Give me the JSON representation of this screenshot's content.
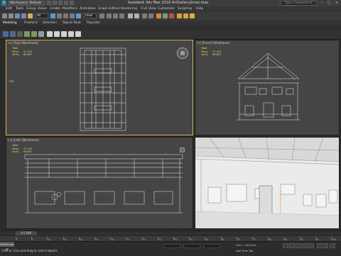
{
  "titlebar": {
    "app_icon": "3ds-max-logo-icon",
    "workspace": "Workspace: Default",
    "title": "Autodesk 3ds Max 2016     ArtGallery2max.max",
    "search_placeholder": "Type a keyword or phrase"
  },
  "menu": {
    "items": [
      "Edit",
      "Tools",
      "Group",
      "Views",
      "Create",
      "Modifiers",
      "Animation",
      "Graph Editors",
      "Rendering",
      "Civil View",
      "Customize",
      "Scripting",
      "Help"
    ]
  },
  "toolbar": {
    "selection_filter": "All",
    "view_dropdown": "View"
  },
  "ribbon": {
    "tabs": [
      "Modeling",
      "Freeform",
      "Selection",
      "Object Paint",
      "Populate"
    ],
    "subtabs": [
      "Selection",
      "Object Paint",
      "Populate"
    ]
  },
  "viewports": {
    "top": {
      "label": "[+] [Top] [Wireframe]",
      "stats_title": "Total",
      "polys_label": "Polys:",
      "polys": "57,415",
      "verts_label": "Verts:",
      "verts": "66,897",
      "fps_label": "FPS:"
    },
    "front": {
      "label": "[+] [Front] [Wireframe]",
      "stats_title": "Total",
      "polys_label": "Polys:",
      "polys": "57,415",
      "verts_label": "Verts:",
      "verts": "66,897"
    },
    "left": {
      "label": "[+] [Left] [Wireframe]",
      "stats_title": "Total",
      "polys_label": "Polys:",
      "polys": "57,415",
      "verts_label": "Verts:",
      "verts": "66,897"
    },
    "perspective": {
      "label": "[+] [Perspective] [Realistic]"
    }
  },
  "timeline": {
    "frame": "0 / 100"
  },
  "trackbar": {
    "ticks": [
      "0",
      "5",
      "10",
      "15",
      "20",
      "25",
      "30",
      "35",
      "40",
      "45",
      "50",
      "55",
      "60",
      "65",
      "70",
      "75",
      "80",
      "85",
      "90",
      "95",
      "100"
    ]
  },
  "statusbar": {
    "maxscript": "MAXScript Mi",
    "message": "Click or click-and-drag to select objects",
    "grid": "Grid = 100.0cm",
    "time_tag": "Add Time Tag",
    "auto_key": "Auto Key",
    "selected": "Selected"
  },
  "colors": {
    "active_border": "#d6b540",
    "stats_text": "#e6d75c",
    "viewport_bg": "#454545"
  }
}
